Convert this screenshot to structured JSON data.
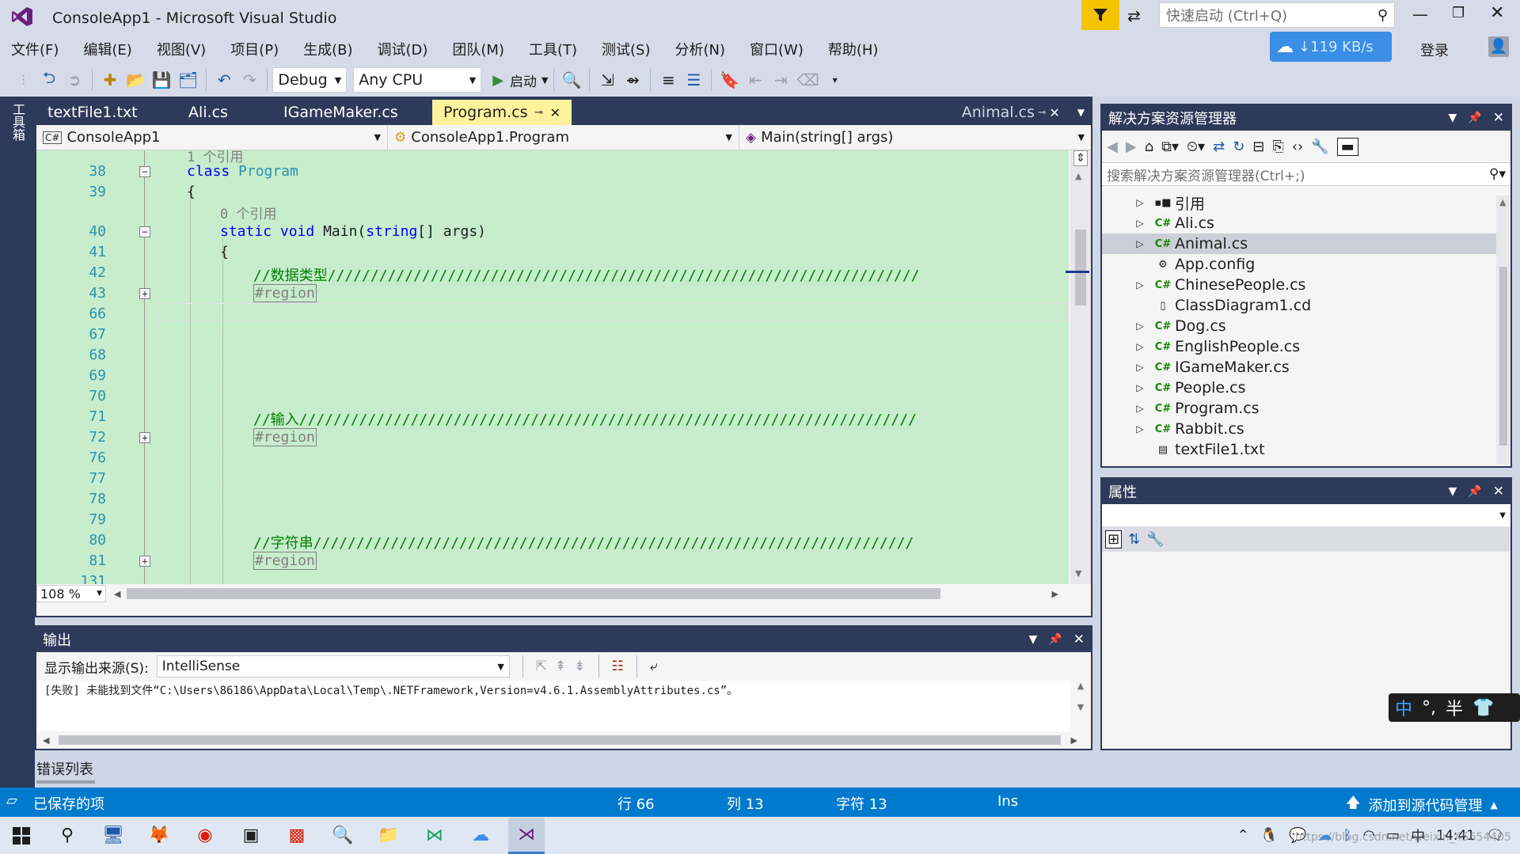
{
  "title": {
    "app_title": "ConsoleApp1 - Microsoft Visual Studio",
    "quick_launch_placeholder": "快速启动 (Ctrl+Q)",
    "speed": "↓119 KB/s",
    "login": "登录"
  },
  "menu": [
    "文件(F)",
    "编辑(E)",
    "视图(V)",
    "项目(P)",
    "生成(B)",
    "调试(D)",
    "团队(M)",
    "工具(T)",
    "测试(S)",
    "分析(N)",
    "窗口(W)",
    "帮助(H)"
  ],
  "toolbar": {
    "config": "Debug",
    "platform": "Any CPU",
    "start": "启动"
  },
  "toolbox_label": "工具箱",
  "tabs": [
    {
      "label": "textFile1.txt",
      "active": false
    },
    {
      "label": "Ali.cs",
      "active": false
    },
    {
      "label": "IGameMaker.cs",
      "active": false
    },
    {
      "label": "Program.cs",
      "active": true
    }
  ],
  "tab_right": "Animal.cs",
  "nav": {
    "project": "ConsoleApp1",
    "class": "ConsoleApp1.Program",
    "member": "Main(string[] args)"
  },
  "code": {
    "ref1": "1 个引用",
    "ref0": "0 个引用",
    "line_numbers": [
      "38",
      "39",
      "40",
      "41",
      "42",
      "43",
      "66",
      "67",
      "68",
      "69",
      "70",
      "71",
      "72",
      "76",
      "77",
      "78",
      "79",
      "80",
      "81",
      "131"
    ],
    "class_kw": "class",
    "class_name": "Program",
    "brace_open": "{",
    "static_kw": "static",
    "void_kw": "void",
    "main_name": "Main(",
    "string_kw": "string",
    "args": "[] args)",
    "comment1": "//数据类型/////////////////////////////////////////////////////////////////////",
    "region": "#region",
    "comment2": "//输入////////////////////////////////////////////////////////////////////////",
    "comment3": "//字符串//////////////////////////////////////////////////////////////////////"
  },
  "zoom": "108 %",
  "solution": {
    "title": "解决方案资源管理器",
    "search_placeholder": "搜索解决方案资源管理器(Ctrl+;)",
    "items": [
      {
        "label": "引用",
        "icon": "references-icon",
        "expandable": true,
        "selected": false
      },
      {
        "label": "Ali.cs",
        "icon": "csharp-file-icon",
        "expandable": true,
        "selected": false
      },
      {
        "label": "Animal.cs",
        "icon": "csharp-file-icon",
        "expandable": true,
        "selected": true
      },
      {
        "label": "App.config",
        "icon": "config-file-icon",
        "expandable": false,
        "selected": false
      },
      {
        "label": "ChinesePeople.cs",
        "icon": "csharp-file-icon",
        "expandable": true,
        "selected": false
      },
      {
        "label": "ClassDiagram1.cd",
        "icon": "diagram-file-icon",
        "expandable": false,
        "selected": false
      },
      {
        "label": "Dog.cs",
        "icon": "csharp-file-icon",
        "expandable": true,
        "selected": false
      },
      {
        "label": "EnglishPeople.cs",
        "icon": "csharp-file-icon",
        "expandable": true,
        "selected": false
      },
      {
        "label": "IGameMaker.cs",
        "icon": "csharp-file-icon",
        "expandable": true,
        "selected": false
      },
      {
        "label": "People.cs",
        "icon": "csharp-file-icon",
        "expandable": true,
        "selected": false
      },
      {
        "label": "Program.cs",
        "icon": "csharp-file-icon",
        "expandable": true,
        "selected": false
      },
      {
        "label": "Rabbit.cs",
        "icon": "csharp-file-icon",
        "expandable": true,
        "selected": false
      },
      {
        "label": "textFile1.txt",
        "icon": "text-file-icon",
        "expandable": false,
        "selected": false
      }
    ]
  },
  "properties": {
    "title": "属性"
  },
  "output": {
    "title": "输出",
    "source_label": "显示输出来源(S):",
    "source_value": "IntelliSense",
    "message": "[失败] 未能找到文件“C:\\Users\\86186\\AppData\\Local\\Temp\\.NETFramework,Version=v4.6.1.AssemblyAttributes.cs”。"
  },
  "error_list": "错误列表",
  "ime": {
    "mode": "中",
    "punct": "°,",
    "width": "半"
  },
  "status": {
    "saved": "已保存的项",
    "line": "行 66",
    "col": "列 13",
    "char": "字符 13",
    "ins": "Ins",
    "source_control": "添加到源代码管理"
  },
  "taskbar": {
    "time": "14:41",
    "watermark": "https://blog.csdn.net/weixin_45654405"
  }
}
